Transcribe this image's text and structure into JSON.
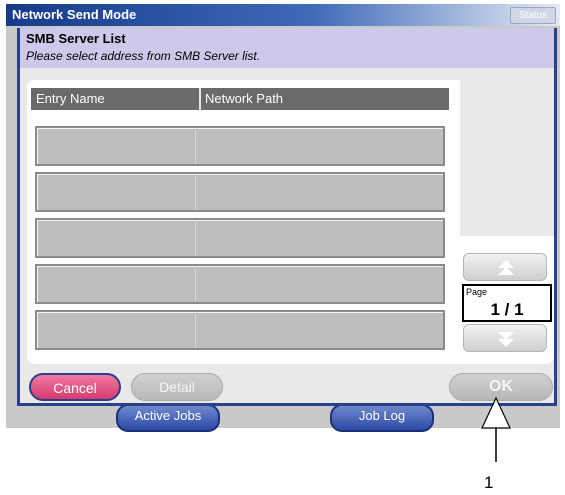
{
  "screen": {
    "title": "Network Send Mode",
    "status_label": "Status",
    "bottom_tabs": [
      "Active Jobs",
      "Job Log"
    ]
  },
  "dialog": {
    "title": "SMB Server List",
    "subtitle": "Please select address from SMB Server list.",
    "columns": [
      "Entry Name",
      "Network Path"
    ],
    "rows": [
      {
        "entry_name": "",
        "network_path": ""
      },
      {
        "entry_name": "",
        "network_path": ""
      },
      {
        "entry_name": "",
        "network_path": ""
      },
      {
        "entry_name": "",
        "network_path": ""
      },
      {
        "entry_name": "",
        "network_path": ""
      }
    ],
    "page": {
      "label": "Page",
      "value": "1 / 1"
    },
    "buttons": {
      "cancel": "Cancel",
      "detail": "Detail",
      "ok": "OK"
    }
  },
  "annotation": {
    "callout": "1"
  },
  "colors": {
    "title_bar": "#183a8c",
    "cancel": "#e2507f",
    "dialog_header": "#cdc9ea"
  }
}
